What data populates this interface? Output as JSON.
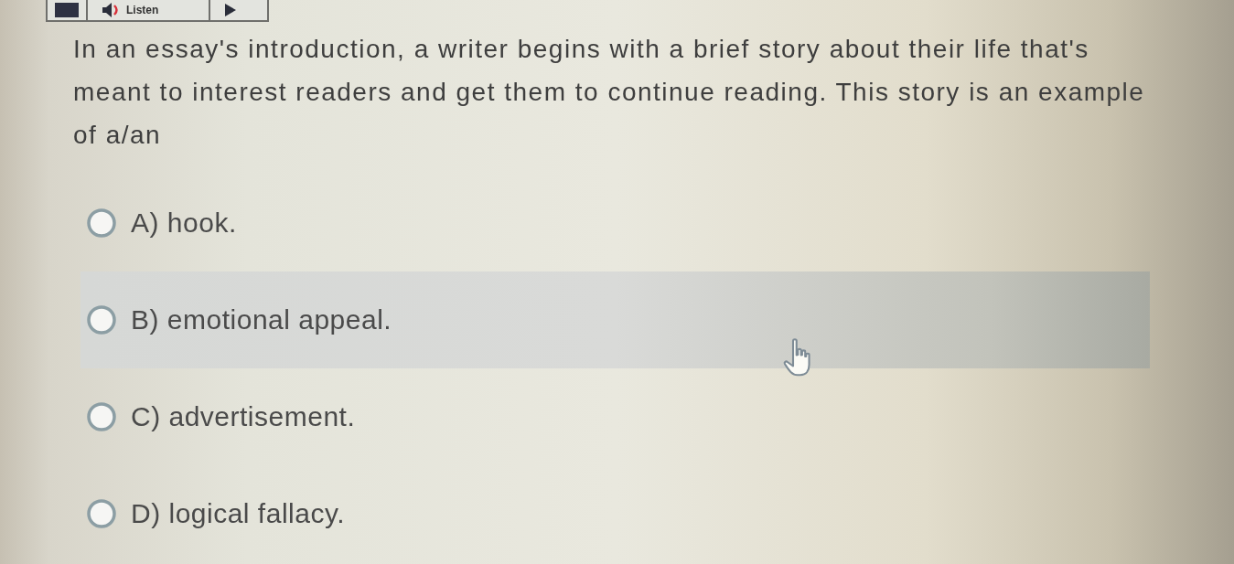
{
  "toolbar": {
    "buttons": [
      {
        "kind": "stop"
      },
      {
        "kind": "listen",
        "label": "Listen"
      },
      {
        "kind": "play"
      }
    ]
  },
  "question": {
    "text": "In an essay's introduction, a writer begins with a brief story about their life that's meant to interest readers and get them to continue reading. This story is an example of a/an"
  },
  "options": [
    {
      "label": "A) hook.",
      "selected": false,
      "hovered": false
    },
    {
      "label": "B) emotional appeal.",
      "selected": false,
      "hovered": true
    },
    {
      "label": "C) advertisement.",
      "selected": false,
      "hovered": false
    },
    {
      "label": "D) logical fallacy.",
      "selected": false,
      "hovered": false
    }
  ]
}
